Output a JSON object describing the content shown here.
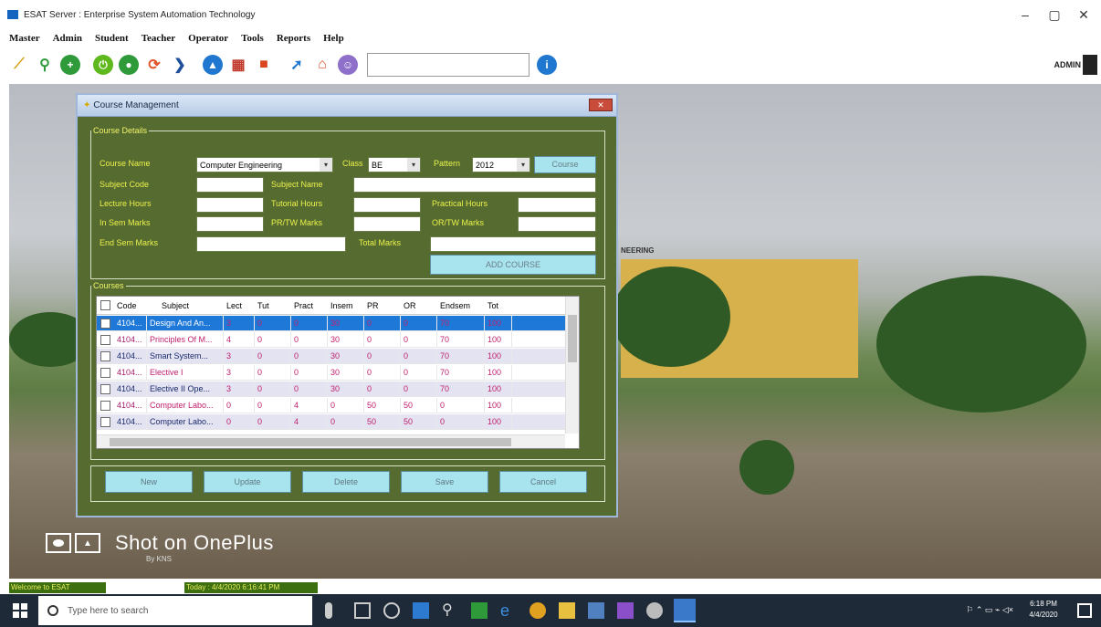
{
  "window": {
    "title": "ESAT Server : Enterprise System Automation Technology",
    "minimize": "–",
    "maximize": "▢",
    "close": "✕"
  },
  "menu": [
    "Master",
    "Admin",
    "Student",
    "Teacher",
    "Operator",
    "Tools",
    "Reports",
    "Help"
  ],
  "toolbar": {
    "search_value": "",
    "user_label": "ADMIN"
  },
  "dialog": {
    "title": "Course Management",
    "close_label": "✕",
    "details_legend": "Course Details",
    "labels": {
      "course_name": "Course Name",
      "class": "Class",
      "pattern": "Pattern",
      "subject_code": "Subject Code",
      "subject_name": "Subject Name",
      "lecture_hours": "Lecture Hours",
      "tutorial_hours": "Tutorial Hours",
      "practical_hours": "Practical Hours",
      "in_sem_marks": "In Sem Marks",
      "pr_tw_marks": "PR/TW Marks",
      "or_tw_marks": "OR/TW Marks",
      "end_sem_marks": "End Sem Marks",
      "total_marks": "Total Marks"
    },
    "values": {
      "course_name": "Computer Engineering",
      "class": "BE",
      "pattern": "2012",
      "subject_code": "",
      "subject_name": "",
      "lecture_hours": "",
      "tutorial_hours": "",
      "practical_hours": "",
      "in_sem_marks": "",
      "pr_tw_marks": "",
      "or_tw_marks": "",
      "end_sem_marks": "",
      "total_marks": ""
    },
    "course_button": "Course",
    "add_course_button": "ADD COURSE",
    "courses_legend": "Courses",
    "grid": {
      "columns": [
        "Code",
        "Subject",
        "Lect",
        "Tut",
        "Pract",
        "Insem",
        "PR",
        "OR",
        "Endsem",
        "Tot"
      ],
      "rows": [
        [
          "4104...",
          "Design And An...",
          "3",
          "0",
          "0",
          "30",
          "0",
          "0",
          "70",
          "100"
        ],
        [
          "4104...",
          "Principles Of M...",
          "4",
          "0",
          "0",
          "30",
          "0",
          "0",
          "70",
          "100"
        ],
        [
          "4104...",
          "Smart System...",
          "3",
          "0",
          "0",
          "30",
          "0",
          "0",
          "70",
          "100"
        ],
        [
          "4104...",
          "Elective I",
          "3",
          "0",
          "0",
          "30",
          "0",
          "0",
          "70",
          "100"
        ],
        [
          "4104...",
          "Elective II Ope...",
          "3",
          "0",
          "0",
          "30",
          "0",
          "0",
          "70",
          "100"
        ],
        [
          "4104...",
          "Computer Labo...",
          "0",
          "0",
          "4",
          "0",
          "50",
          "50",
          "0",
          "100"
        ],
        [
          "4104...",
          "Computer Labo...",
          "0",
          "0",
          "4",
          "0",
          "50",
          "50",
          "0",
          "100"
        ]
      ]
    },
    "buttons": {
      "new": "New",
      "update": "Update",
      "delete": "Delete",
      "save": "Save",
      "cancel": "Cancel"
    }
  },
  "background": {
    "building_sign": "NEERING",
    "watermark_main": "Shot on OnePlus",
    "watermark_sub": "By KNS"
  },
  "status": {
    "welcome": "Welcome to ESAT",
    "today": "Today : 4/4/2020 6:16:41 PM"
  },
  "taskbar": {
    "search_placeholder": "Type here to search",
    "time": "6:18 PM",
    "date": "4/4/2020"
  },
  "colors": {
    "dialog_bg": "#556b2f",
    "label_yellow": "#ecf34c",
    "button_cyan": "#a8e4ee",
    "selected_row": "#1e78d8",
    "status_green": "#3d6e10"
  }
}
